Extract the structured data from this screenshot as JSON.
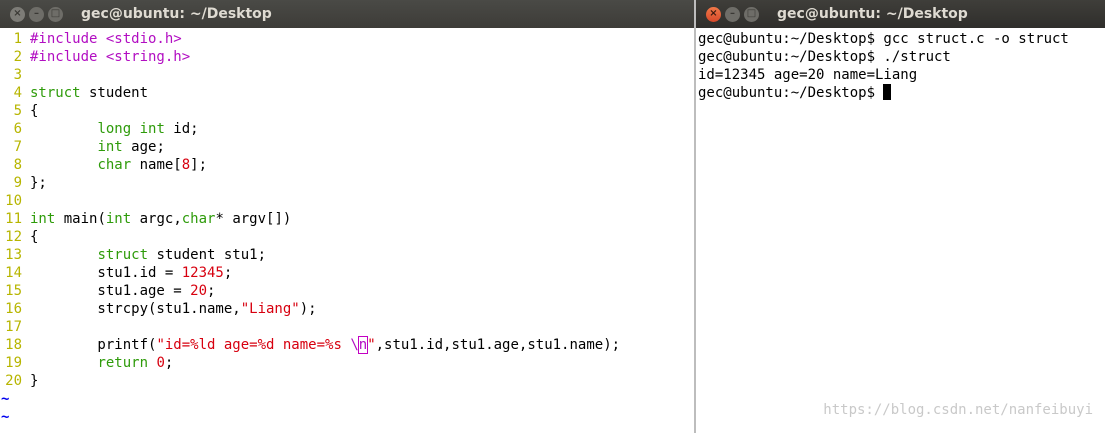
{
  "left_window": {
    "title": "gec@ubuntu: ~/Desktop",
    "buttons": {
      "close": "×",
      "minimize": "–",
      "maximize": "□"
    },
    "tilde": "~",
    "lines": [
      {
        "num": "1",
        "segs": [
          {
            "t": "#include <stdio.h>",
            "c": "pp"
          }
        ]
      },
      {
        "num": "2",
        "segs": [
          {
            "t": "#include <string.h>",
            "c": "pp"
          }
        ]
      },
      {
        "num": "3",
        "segs": []
      },
      {
        "num": "4",
        "segs": [
          {
            "t": "struct",
            "c": "ty"
          },
          {
            "t": " student"
          }
        ]
      },
      {
        "num": "5",
        "segs": [
          {
            "t": "{"
          }
        ]
      },
      {
        "num": "6",
        "segs": [
          {
            "t": "        "
          },
          {
            "t": "long int",
            "c": "ty"
          },
          {
            "t": " id;"
          }
        ]
      },
      {
        "num": "7",
        "segs": [
          {
            "t": "        "
          },
          {
            "t": "int",
            "c": "ty"
          },
          {
            "t": " age;"
          }
        ]
      },
      {
        "num": "8",
        "segs": [
          {
            "t": "        "
          },
          {
            "t": "char",
            "c": "ty"
          },
          {
            "t": " name["
          },
          {
            "t": "8",
            "c": "num"
          },
          {
            "t": "];"
          }
        ]
      },
      {
        "num": "9",
        "segs": [
          {
            "t": "};"
          }
        ]
      },
      {
        "num": "10",
        "segs": []
      },
      {
        "num": "11",
        "segs": [
          {
            "t": "int",
            "c": "ty"
          },
          {
            "t": " main("
          },
          {
            "t": "int",
            "c": "ty"
          },
          {
            "t": " argc,"
          },
          {
            "t": "char",
            "c": "ty"
          },
          {
            "t": "* argv[])"
          }
        ]
      },
      {
        "num": "12",
        "segs": [
          {
            "t": "{"
          }
        ]
      },
      {
        "num": "13",
        "segs": [
          {
            "t": "        "
          },
          {
            "t": "struct",
            "c": "ty"
          },
          {
            "t": " student stu1;"
          }
        ]
      },
      {
        "num": "14",
        "segs": [
          {
            "t": "        stu1.id = "
          },
          {
            "t": "12345",
            "c": "num"
          },
          {
            "t": ";"
          }
        ]
      },
      {
        "num": "15",
        "segs": [
          {
            "t": "        stu1.age = "
          },
          {
            "t": "20",
            "c": "num"
          },
          {
            "t": ";"
          }
        ]
      },
      {
        "num": "16",
        "segs": [
          {
            "t": "        strcpy(stu1.name,"
          },
          {
            "t": "\"Liang\"",
            "c": "str"
          },
          {
            "t": ");"
          }
        ]
      },
      {
        "num": "17",
        "segs": []
      },
      {
        "num": "18",
        "segs": [
          {
            "t": "        printf("
          },
          {
            "t": "\"id=%ld age=%d name=%s ",
            "c": "str"
          },
          {
            "t": "\\",
            "c": "esc"
          },
          {
            "t": "n",
            "c": "esc hl"
          },
          {
            "t": "\"",
            "c": "str"
          },
          {
            "t": ",stu1.id,stu1.age,stu1.name);"
          }
        ]
      },
      {
        "num": "19",
        "segs": [
          {
            "t": "        "
          },
          {
            "t": "return",
            "c": "ty"
          },
          {
            "t": " "
          },
          {
            "t": "0",
            "c": "num"
          },
          {
            "t": ";"
          }
        ]
      },
      {
        "num": "20",
        "segs": [
          {
            "t": "}"
          }
        ]
      }
    ],
    "tilde_rows": 2
  },
  "right_window": {
    "title": "gec@ubuntu: ~/Desktop",
    "buttons": {
      "close": "×",
      "minimize": "–",
      "maximize": "□"
    },
    "lines": [
      "gec@ubuntu:~/Desktop$ gcc struct.c -o struct",
      "gec@ubuntu:~/Desktop$ ./struct",
      "id=12345 age=20 name=Liang",
      "gec@ubuntu:~/Desktop$ "
    ]
  },
  "watermark": "https://blog.csdn.net/nanfeibuyi"
}
